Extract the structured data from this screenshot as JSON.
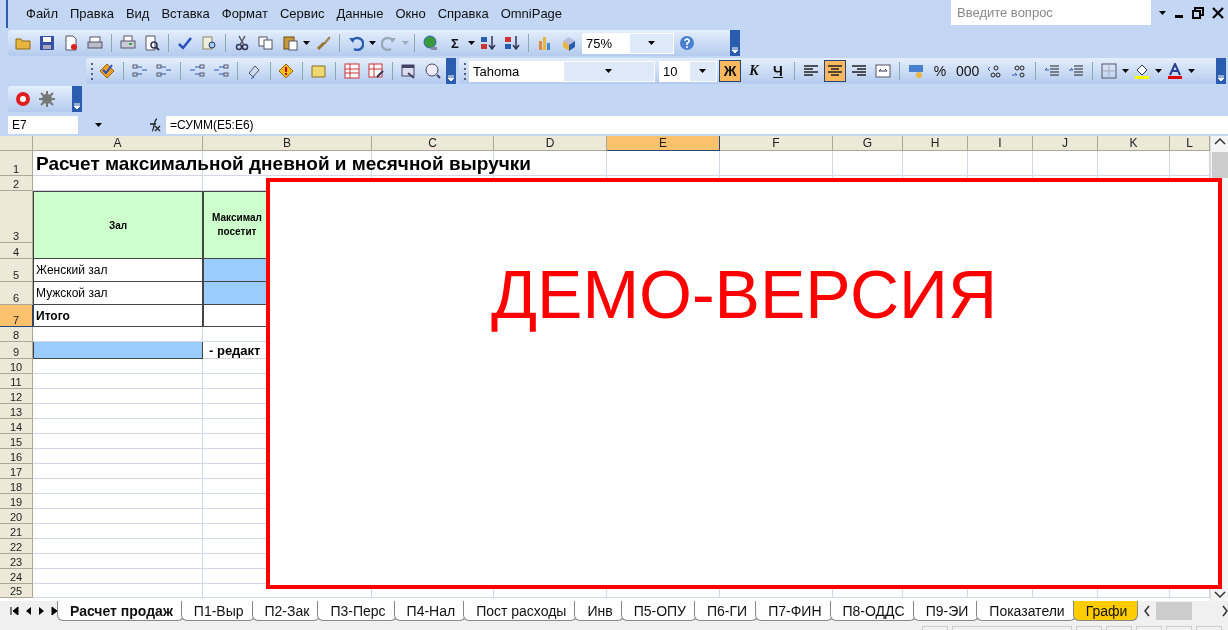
{
  "menu": [
    "Файл",
    "Правка",
    "Вид",
    "Вставка",
    "Формат",
    "Сервис",
    "Данные",
    "Окно",
    "Справка",
    "OmniPage"
  ],
  "help_search": {
    "placeholder": "Введите вопрос"
  },
  "toolbar": {
    "sum_symbol": "Σ",
    "zoom": "75%",
    "font": "Tahoma",
    "font_size": "10",
    "styles": [
      {
        "label": "Ж",
        "selected": true
      },
      {
        "label": "К",
        "selected": false
      },
      {
        "label": "Ч",
        "selected": false
      }
    ],
    "alignments": [
      {
        "selected": false
      },
      {
        "selected": true
      },
      {
        "selected": false
      },
      {
        "selected": false
      }
    ],
    "number_formats": [
      "%",
      "000"
    ]
  },
  "formula_bar": {
    "name_box": "E7",
    "formula": "=СУММ(E5:E6)"
  },
  "sheet": {
    "columns": [
      {
        "label": "A",
        "selected": false
      },
      {
        "label": "B",
        "selected": false
      },
      {
        "label": "C",
        "selected": false
      },
      {
        "label": "D",
        "selected": false
      },
      {
        "label": "E",
        "selected": true
      },
      {
        "label": "F",
        "selected": false
      },
      {
        "label": "G",
        "selected": false
      },
      {
        "label": "H",
        "selected": false
      },
      {
        "label": "I",
        "selected": false
      },
      {
        "label": "J",
        "selected": false
      },
      {
        "label": "K",
        "selected": false
      },
      {
        "label": "L",
        "selected": false
      }
    ],
    "rows": [
      {
        "number": "1",
        "selected": false,
        "cells": [
          {
            "text": "Расчет максимальной дневной и месячной выручки",
            "kind": "title"
          }
        ]
      },
      {
        "number": "2",
        "selected": false,
        "cells": []
      },
      {
        "number": "3",
        "selected": false,
        "cells": [
          {
            "text": "Зал",
            "kind": "header",
            "rowspan": 2
          },
          {
            "text": "Максимал посетит",
            "kind": "header",
            "rowspan": 2
          }
        ]
      },
      {
        "number": "4",
        "selected": false,
        "cells": []
      },
      {
        "number": "5",
        "selected": false,
        "cells": [
          {
            "text": "Женский зал",
            "kind": "label"
          },
          {
            "kind": "input"
          }
        ]
      },
      {
        "number": "6",
        "selected": false,
        "cells": [
          {
            "text": "Мужской зал",
            "kind": "label"
          },
          {
            "kind": "input"
          }
        ]
      },
      {
        "number": "7",
        "selected": true,
        "cells": [
          {
            "text": "Итого",
            "kind": "total"
          },
          {
            "kind": "bordered"
          }
        ]
      },
      {
        "number": "8",
        "selected": false,
        "cells": []
      },
      {
        "number": "9",
        "selected": false,
        "cells": [
          {
            "kind": "input"
          },
          {
            "text": "- редакт",
            "kind": "note"
          }
        ]
      },
      {
        "number": "10",
        "selected": false,
        "cells": []
      },
      {
        "number": "11",
        "selected": false,
        "cells": []
      },
      {
        "number": "12",
        "selected": false,
        "cells": []
      },
      {
        "number": "13",
        "selected": false,
        "cells": []
      },
      {
        "number": "14",
        "selected": false,
        "cells": []
      },
      {
        "number": "15",
        "selected": false,
        "cells": []
      },
      {
        "number": "16",
        "selected": false,
        "cells": []
      },
      {
        "number": "17",
        "selected": false,
        "cells": []
      },
      {
        "number": "18",
        "selected": false,
        "cells": []
      },
      {
        "number": "19",
        "selected": false,
        "cells": []
      },
      {
        "number": "20",
        "selected": false,
        "cells": []
      },
      {
        "number": "21",
        "selected": false,
        "cells": []
      },
      {
        "number": "22",
        "selected": false,
        "cells": []
      },
      {
        "number": "23",
        "selected": false,
        "cells": []
      },
      {
        "number": "24",
        "selected": false,
        "cells": []
      },
      {
        "number": "25",
        "selected": false,
        "cells": []
      }
    ]
  },
  "demo_overlay": {
    "text": "ДЕМО-ВЕРСИЯ"
  },
  "sheet_tabs": [
    {
      "label": "Расчет продаж",
      "selected": true
    },
    {
      "label": "П1-Выр",
      "selected": false
    },
    {
      "label": "П2-Зак",
      "selected": false
    },
    {
      "label": "П3-Перс",
      "selected": false
    },
    {
      "label": "П4-Нал",
      "selected": false
    },
    {
      "label": "Пост расходы",
      "selected": false
    },
    {
      "label": "Инв",
      "selected": false
    },
    {
      "label": "П5-ОПУ",
      "selected": false
    },
    {
      "label": "П6-ГИ",
      "selected": false
    },
    {
      "label": "П7-ФИН",
      "selected": false
    },
    {
      "label": "П8-ОДДС",
      "selected": false
    },
    {
      "label": "П9-ЭИ",
      "selected": false
    },
    {
      "label": "Показатели",
      "selected": false
    },
    {
      "label": "Графи",
      "selected": false,
      "color": "#ffcc00"
    }
  ]
}
